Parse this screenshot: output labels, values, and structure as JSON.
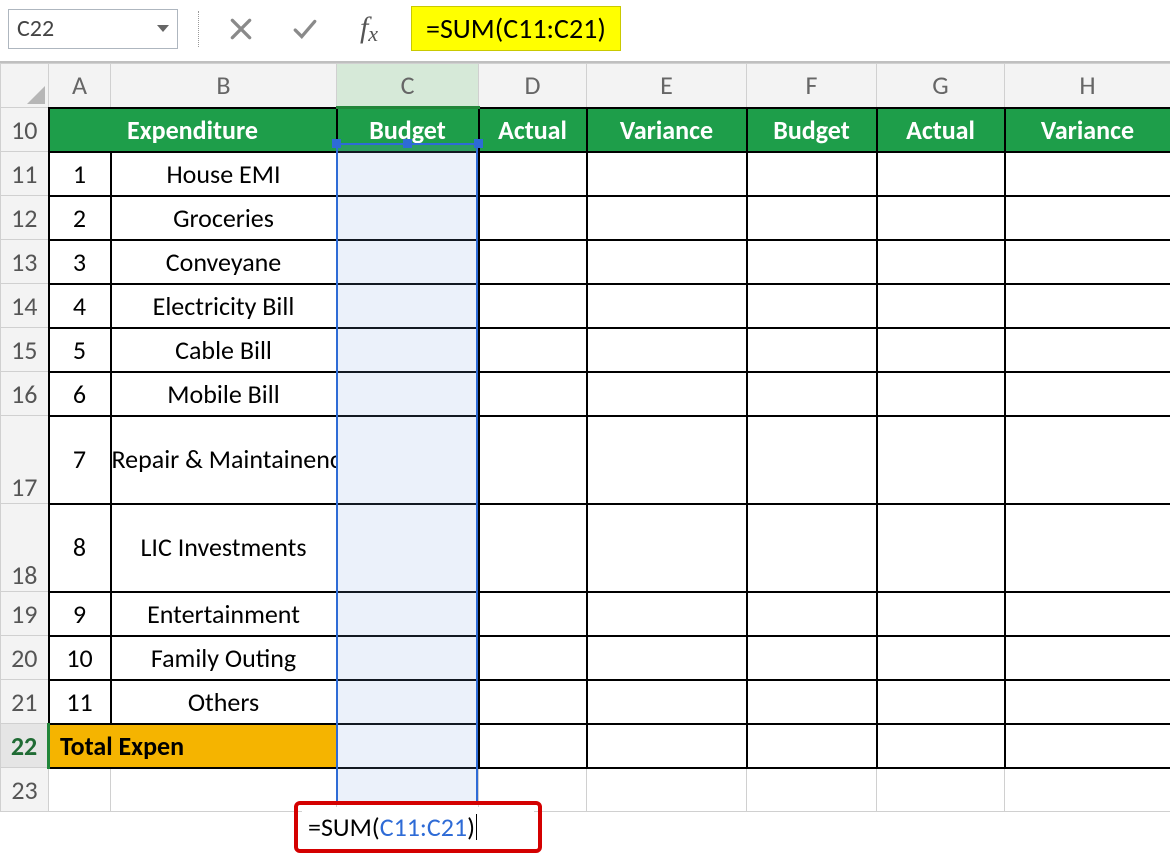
{
  "formula_bar": {
    "namebox_value": "C22",
    "formula_display": "=SUM(C11:C21)"
  },
  "column_letters": [
    "A",
    "B",
    "C",
    "D",
    "E",
    "F",
    "G",
    "H"
  ],
  "header_row": {
    "row_num": "10",
    "expenditure": "Expenditure",
    "budget1": "Budget",
    "actual1": "Actual",
    "variance1": "Variance",
    "budget2": "Budget",
    "actual2": "Actual",
    "variance2": "Variance"
  },
  "items": [
    {
      "row": "11",
      "n": "1",
      "label": "House EMI"
    },
    {
      "row": "12",
      "n": "2",
      "label": "Groceries"
    },
    {
      "row": "13",
      "n": "3",
      "label": "Conveyane"
    },
    {
      "row": "14",
      "n": "4",
      "label": "Electricity Bill"
    },
    {
      "row": "15",
      "n": "5",
      "label": "Cable Bill"
    },
    {
      "row": "16",
      "n": "6",
      "label": "Mobile Bill"
    },
    {
      "row": "17",
      "n": "7",
      "label": "Repair & Maintainence"
    },
    {
      "row": "18",
      "n": "8",
      "label": "LIC Investments"
    },
    {
      "row": "19",
      "n": "9",
      "label": "Entertainment"
    },
    {
      "row": "20",
      "n": "10",
      "label": "Family Outing"
    },
    {
      "row": "21",
      "n": "11",
      "label": "Others"
    }
  ],
  "total_row": {
    "row": "22",
    "label": "Total Expen",
    "formula_prefix": "=SUM(",
    "formula_ref": "C11:C21",
    "formula_suffix": ")"
  },
  "extra_row": {
    "row": "23"
  },
  "selection": {
    "range_ref": "C11:C21",
    "active_cell": "C22"
  }
}
